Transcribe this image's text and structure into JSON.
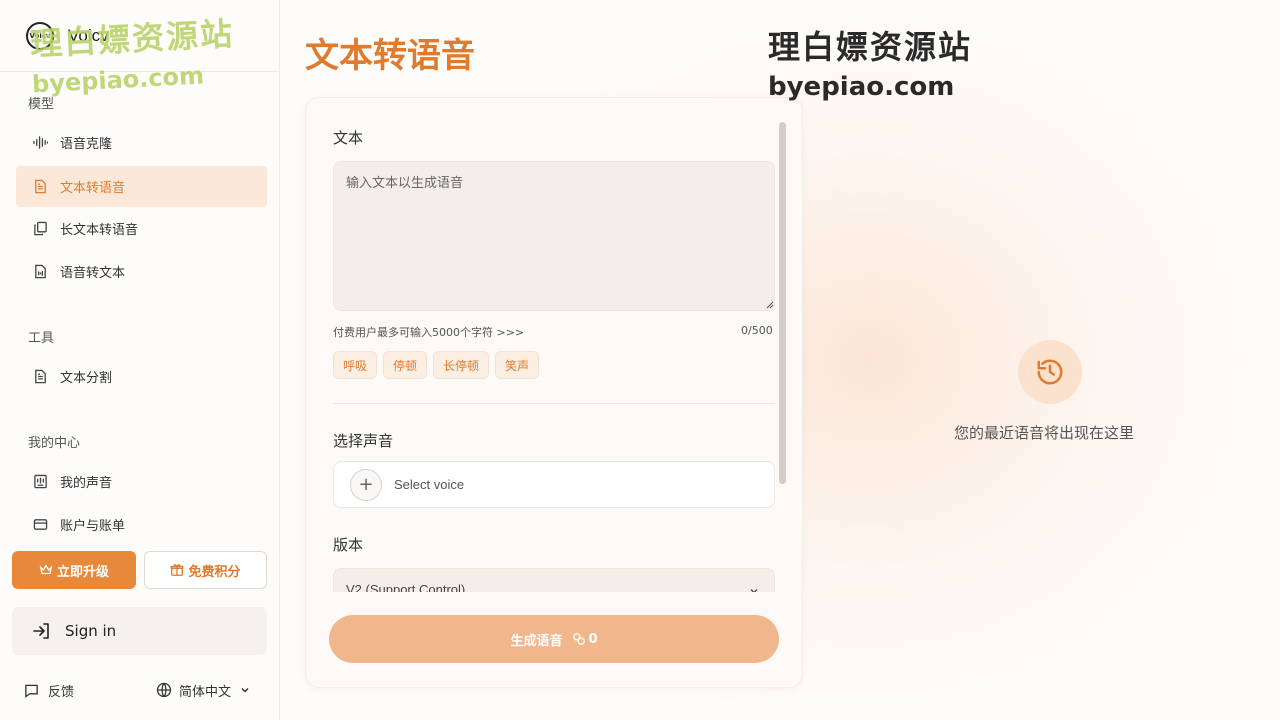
{
  "brand": {
    "logo_text": "Voicv",
    "logo_mark": "Voicv",
    "name": "Voicv"
  },
  "sidebar": {
    "section_models": "模型",
    "models": [
      {
        "label": "语音克隆",
        "icon": "waveform-icon"
      },
      {
        "label": "文本转语音",
        "icon": "document-icon",
        "active": true
      },
      {
        "label": "长文本转语音",
        "icon": "copy-documents-icon"
      },
      {
        "label": "语音转文本",
        "icon": "audio-file-icon"
      }
    ],
    "section_tools": "工具",
    "tools": [
      {
        "label": "文本分割",
        "icon": "document-icon"
      }
    ],
    "section_me": "我的中心",
    "me": [
      {
        "label": "我的声音",
        "icon": "voice-library-icon"
      },
      {
        "label": "账户与账单",
        "icon": "credit-card-icon"
      }
    ],
    "upgrade_label": "立即升级",
    "free_label": "免费积分",
    "signin_label": "Sign in",
    "feedback_label": "反馈",
    "language_label": "简体中文"
  },
  "main": {
    "title": "文本转语音",
    "text_label": "文本",
    "text_placeholder": "输入文本以生成语音",
    "hint": "付费用户最多可输入5000个字符 >>>",
    "counter": "0/500",
    "tags": [
      "呼吸",
      "停顿",
      "长停顿",
      "笑声"
    ],
    "voice_label": "选择声音",
    "voice_placeholder": "Select voice",
    "version_label": "版本",
    "version_value": "V2 (Support Control)",
    "generate_label": "生成语音",
    "generate_cost": "0"
  },
  "history": {
    "empty_text": "您的最近语音将出现在这里"
  },
  "watermark": {
    "line1": "理白嫖资源站",
    "line2": "byepiao.com"
  },
  "colors": {
    "accent": "#e07a2c",
    "button": "#e8883a",
    "generate_disabled": "#f0b68c"
  }
}
